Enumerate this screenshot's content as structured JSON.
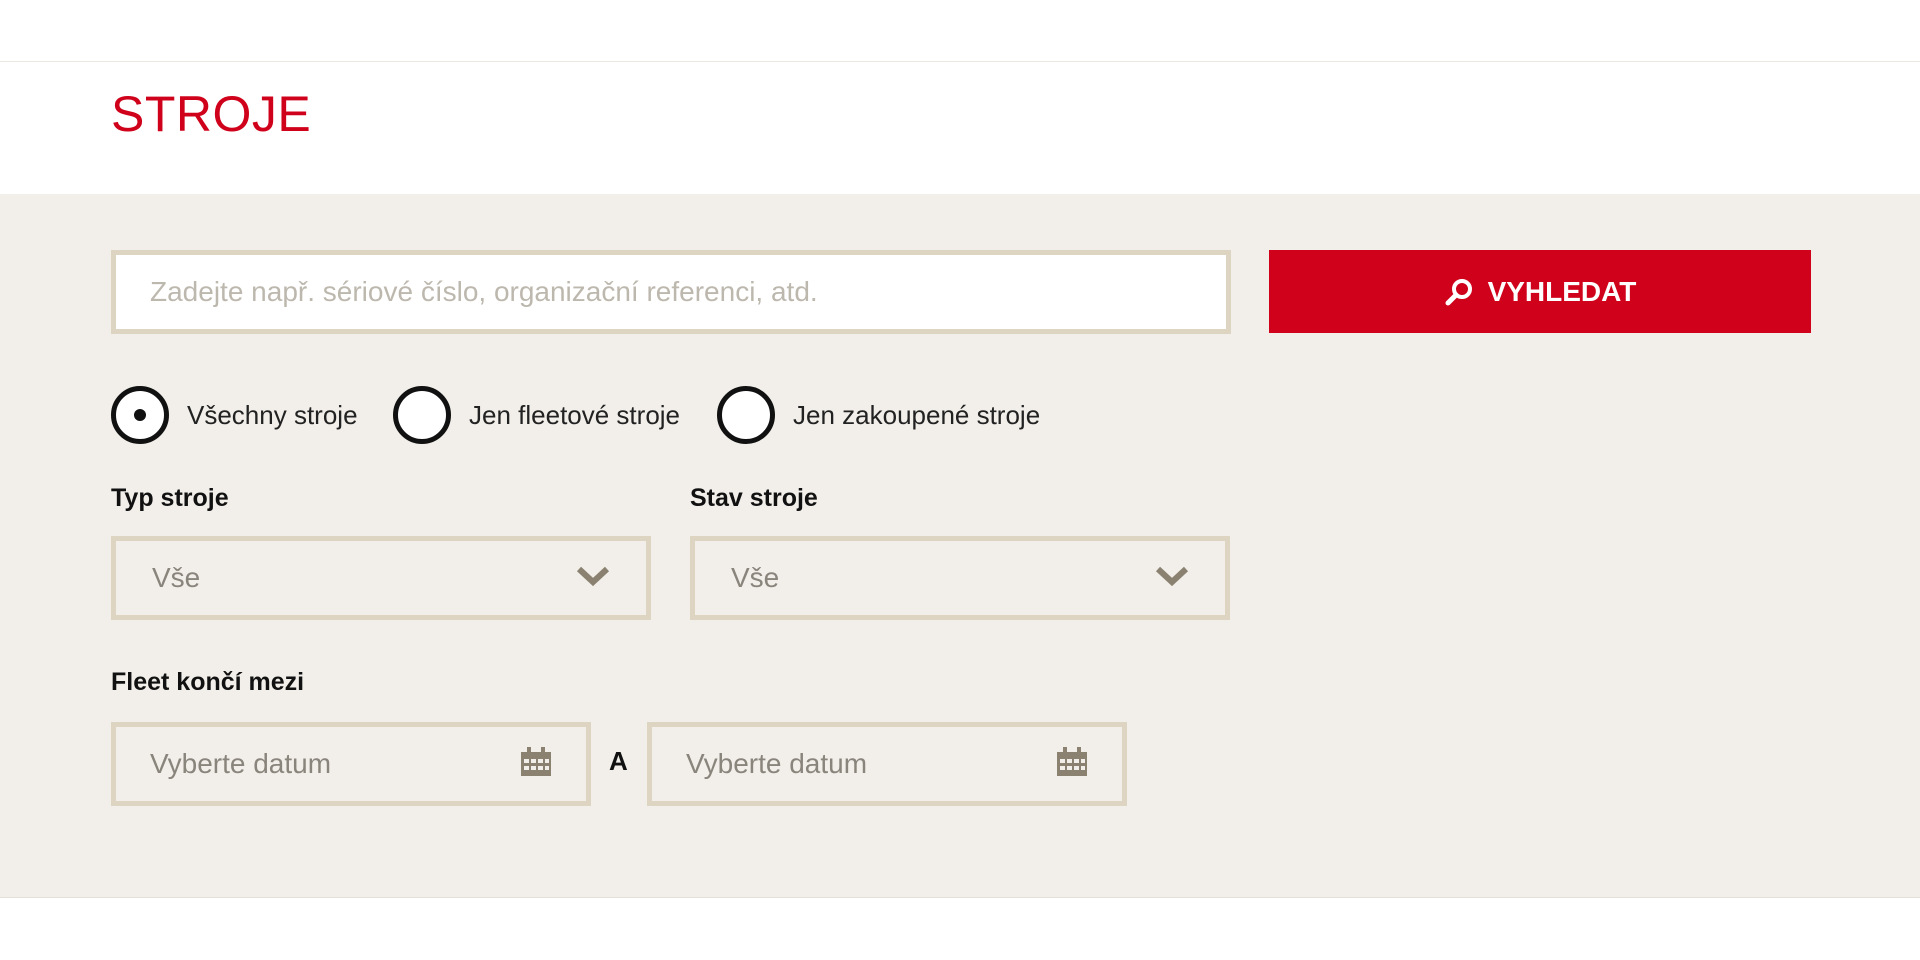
{
  "header": {
    "title": "STROJE"
  },
  "search": {
    "placeholder": "Zadejte např. sériové číslo, organizační referenci, atd.",
    "button_label": "VYHLEDAT"
  },
  "ownership_filter": {
    "options": [
      {
        "label": "Všechny stroje",
        "checked": true
      },
      {
        "label": "Jen fleetové stroje",
        "checked": false
      },
      {
        "label": "Jen zakoupené stroje",
        "checked": false
      }
    ]
  },
  "machine_type": {
    "label": "Typ stroje",
    "value": "Vše"
  },
  "machine_status": {
    "label": "Stav stroje",
    "value": "Vše"
  },
  "fleet_end": {
    "label": "Fleet končí mezi",
    "from_placeholder": "Vyberte datum",
    "separator": "A",
    "to_placeholder": "Vyberte datum"
  },
  "colors": {
    "accent": "#d0021b",
    "panel_background": "#f2efea",
    "field_border": "#ddd4c2",
    "icon_color": "#8a8170"
  },
  "icons": [
    "search-icon",
    "chevron-down-icon",
    "calendar-icon"
  ]
}
